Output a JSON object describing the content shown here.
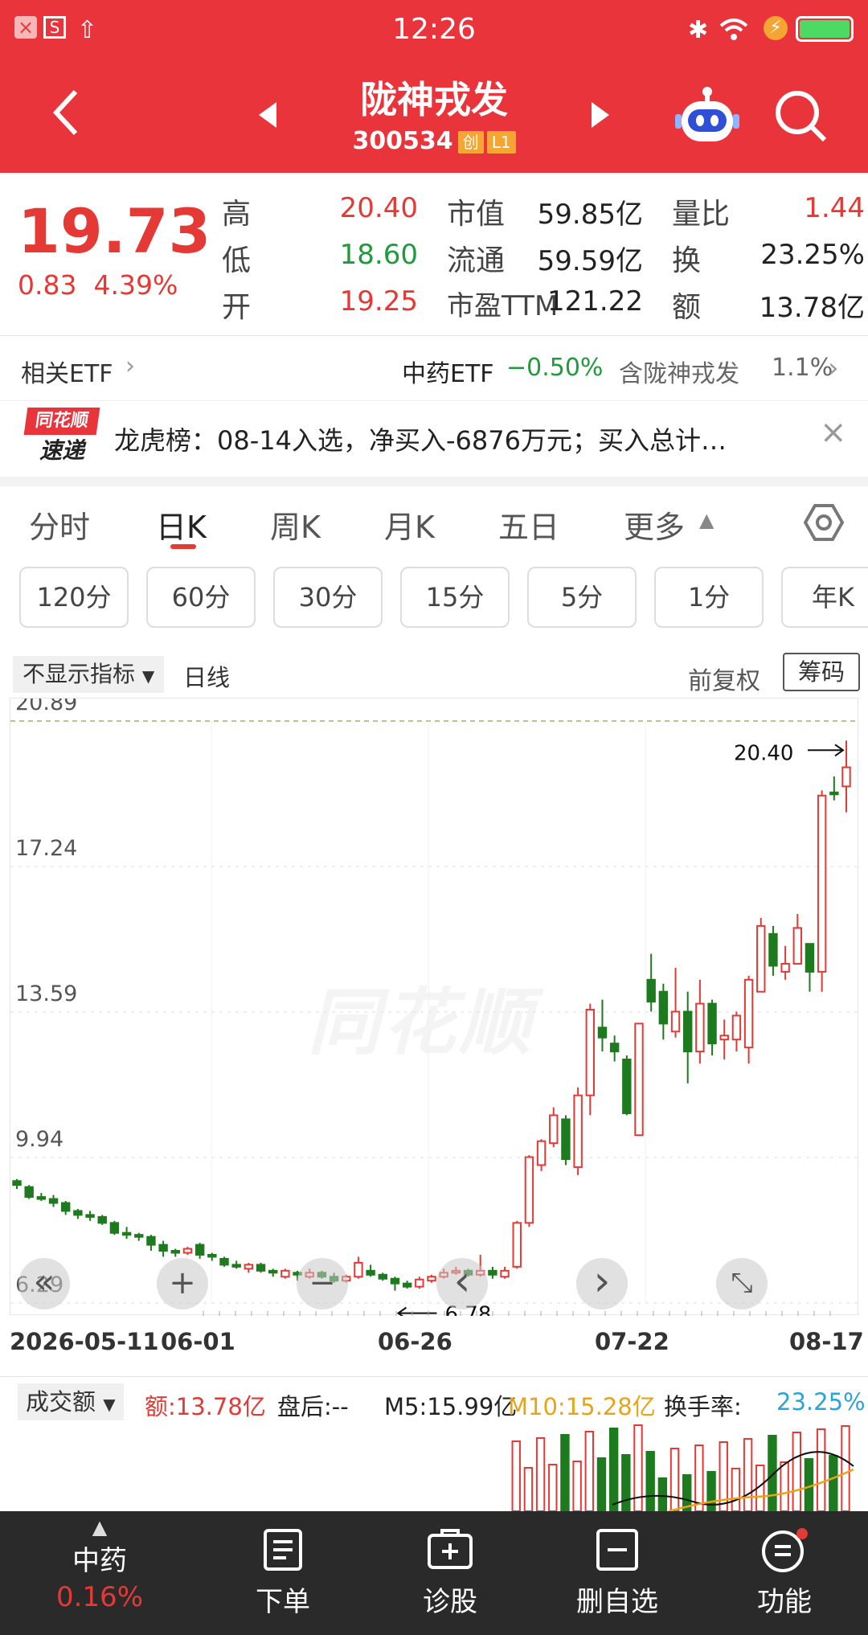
{
  "status_bar": {
    "time": "12:26"
  },
  "header": {
    "stock_name": "陇神戎发",
    "stock_code": "300534",
    "badge1": "创",
    "badge2": "L1"
  },
  "quote": {
    "price": "19.73",
    "change": "0.83",
    "change_pct": "4.39%",
    "high_label": "高",
    "high": "20.40",
    "low_label": "低",
    "low": "18.60",
    "open_label": "开",
    "open": "19.25",
    "mktcap_label": "市值",
    "mktcap": "59.85亿",
    "float_label": "流通",
    "float": "59.59亿",
    "pe_label": "市盈TTM",
    "pe": "121.22",
    "volratio_label": "量比",
    "volratio": "1.44",
    "turnover_label": "换",
    "turnover": "23.25%",
    "amount_label": "额",
    "amount": "13.78亿"
  },
  "etf": {
    "label": "相关ETF",
    "name": "中药ETF",
    "change": "−0.50%",
    "contains": "含陇神戎发",
    "weight": "1.1%"
  },
  "news": {
    "logo_top": "同花顺",
    "logo_bottom": "速递",
    "text": "龙虎榜：08-14入选，净买入-6876万元；买入总计…"
  },
  "tabs": [
    "分时",
    "日K",
    "周K",
    "月K",
    "五日",
    "更多"
  ],
  "periods": [
    "120分",
    "60分",
    "30分",
    "15分",
    "5分",
    "1分",
    "年K"
  ],
  "chart_header": {
    "indicator": "不显示指标",
    "line_type": "日线",
    "adjust": "前复权",
    "chips": "筹码"
  },
  "chart_data": {
    "type": "candlestick",
    "y_ticks": [
      "20.89",
      "17.24",
      "13.59",
      "9.94",
      "6.29"
    ],
    "ylim": [
      6.29,
      20.89
    ],
    "x_labels": [
      "2026-05-11",
      "06-01",
      "06-26",
      "07-22",
      "08-17"
    ],
    "max_marker": "20.40",
    "min_marker": "6.78",
    "candles": [
      {
        "o": 9.35,
        "c": 9.25,
        "h": 9.4,
        "l": 9.15
      },
      {
        "o": 9.2,
        "c": 8.95,
        "h": 9.25,
        "l": 8.9
      },
      {
        "o": 8.95,
        "c": 8.9,
        "h": 9.05,
        "l": 8.85
      },
      {
        "o": 8.9,
        "c": 8.8,
        "h": 9.0,
        "l": 8.7
      },
      {
        "o": 8.8,
        "c": 8.6,
        "h": 8.85,
        "l": 8.5
      },
      {
        "o": 8.6,
        "c": 8.5,
        "h": 8.65,
        "l": 8.4
      },
      {
        "o": 8.5,
        "c": 8.45,
        "h": 8.6,
        "l": 8.35
      },
      {
        "o": 8.45,
        "c": 8.3,
        "h": 8.5,
        "l": 8.25
      },
      {
        "o": 8.3,
        "c": 8.05,
        "h": 8.35,
        "l": 8.0
      },
      {
        "o": 8.05,
        "c": 8.0,
        "h": 8.2,
        "l": 7.9
      },
      {
        "o": 8.0,
        "c": 7.95,
        "h": 8.05,
        "l": 7.85
      },
      {
        "o": 7.95,
        "c": 7.75,
        "h": 8.0,
        "l": 7.6
      },
      {
        "o": 7.75,
        "c": 7.6,
        "h": 7.85,
        "l": 7.45
      },
      {
        "o": 7.6,
        "c": 7.55,
        "h": 7.65,
        "l": 7.45
      },
      {
        "o": 7.55,
        "c": 7.65,
        "h": 7.7,
        "l": 7.5
      },
      {
        "o": 7.75,
        "c": 7.5,
        "h": 7.8,
        "l": 7.4
      },
      {
        "o": 7.5,
        "c": 7.45,
        "h": 7.55,
        "l": 7.35
      },
      {
        "o": 7.4,
        "c": 7.25,
        "h": 7.45,
        "l": 7.2
      },
      {
        "o": 7.25,
        "c": 7.2,
        "h": 7.35,
        "l": 7.15
      },
      {
        "o": 7.15,
        "c": 7.25,
        "h": 7.3,
        "l": 7.05
      },
      {
        "o": 7.25,
        "c": 7.1,
        "h": 7.3,
        "l": 7.05
      },
      {
        "o": 7.1,
        "c": 7.05,
        "h": 7.15,
        "l": 6.95
      },
      {
        "o": 6.95,
        "c": 7.1,
        "h": 7.15,
        "l": 6.9
      },
      {
        "o": 7.05,
        "c": 7.0,
        "h": 7.1,
        "l": 6.85
      },
      {
        "o": 6.95,
        "c": 7.05,
        "h": 7.15,
        "l": 6.9
      },
      {
        "o": 7.05,
        "c": 6.95,
        "h": 7.1,
        "l": 6.9
      },
      {
        "o": 6.95,
        "c": 6.85,
        "h": 7.05,
        "l": 6.8
      },
      {
        "o": 6.85,
        "c": 6.95,
        "h": 7.0,
        "l": 6.8
      },
      {
        "o": 6.95,
        "c": 7.3,
        "h": 7.45,
        "l": 6.9
      },
      {
        "o": 7.1,
        "c": 7.0,
        "h": 7.25,
        "l": 6.95
      },
      {
        "o": 7.0,
        "c": 6.9,
        "h": 7.05,
        "l": 6.85
      },
      {
        "o": 6.9,
        "c": 6.78,
        "h": 6.95,
        "l": 6.6
      },
      {
        "o": 6.78,
        "c": 6.7,
        "h": 6.85,
        "l": 6.65
      },
      {
        "o": 6.7,
        "c": 6.88,
        "h": 6.95,
        "l": 6.65
      },
      {
        "o": 6.85,
        "c": 6.95,
        "h": 7.0,
        "l": 6.8
      },
      {
        "o": 6.95,
        "c": 7.05,
        "h": 7.15,
        "l": 6.9
      },
      {
        "o": 7.05,
        "c": 7.1,
        "h": 7.2,
        "l": 7.0
      },
      {
        "o": 7.1,
        "c": 7.0,
        "h": 7.15,
        "l": 6.95
      },
      {
        "o": 7.0,
        "c": 7.1,
        "h": 7.5,
        "l": 6.95
      },
      {
        "o": 7.1,
        "c": 7.0,
        "h": 7.2,
        "l": 6.9
      },
      {
        "o": 6.95,
        "c": 7.1,
        "h": 7.2,
        "l": 6.9
      },
      {
        "o": 7.2,
        "c": 8.3,
        "h": 8.35,
        "l": 7.15
      },
      {
        "o": 8.3,
        "c": 9.95,
        "h": 10.0,
        "l": 8.2
      },
      {
        "o": 9.75,
        "c": 10.35,
        "h": 10.4,
        "l": 9.6
      },
      {
        "o": 10.3,
        "c": 11.0,
        "h": 11.2,
        "l": 10.2
      },
      {
        "o": 10.9,
        "c": 9.9,
        "h": 11.0,
        "l": 9.75
      },
      {
        "o": 9.7,
        "c": 11.5,
        "h": 11.7,
        "l": 9.5
      },
      {
        "o": 11.5,
        "c": 13.65,
        "h": 13.8,
        "l": 11.0
      },
      {
        "o": 13.2,
        "c": 12.95,
        "h": 13.9,
        "l": 12.6
      },
      {
        "o": 12.8,
        "c": 12.6,
        "h": 13.0,
        "l": 12.35
      },
      {
        "o": 12.4,
        "c": 11.05,
        "h": 12.5,
        "l": 11.0
      },
      {
        "o": 10.5,
        "c": 13.3,
        "h": 13.3,
        "l": 10.5
      },
      {
        "o": 14.4,
        "c": 13.85,
        "h": 15.05,
        "l": 13.6
      },
      {
        "o": 14.1,
        "c": 13.3,
        "h": 14.3,
        "l": 12.9
      },
      {
        "o": 13.1,
        "c": 13.6,
        "h": 14.7,
        "l": 12.95
      },
      {
        "o": 13.6,
        "c": 12.6,
        "h": 14.1,
        "l": 11.8
      },
      {
        "o": 12.6,
        "c": 13.8,
        "h": 14.4,
        "l": 12.3
      },
      {
        "o": 13.8,
        "c": 12.8,
        "h": 13.9,
        "l": 12.5
      },
      {
        "o": 12.9,
        "c": 13.0,
        "h": 13.4,
        "l": 12.4
      },
      {
        "o": 12.9,
        "c": 13.5,
        "h": 13.6,
        "l": 12.6
      },
      {
        "o": 12.7,
        "c": 14.4,
        "h": 14.5,
        "l": 12.3
      },
      {
        "o": 14.1,
        "c": 15.75,
        "h": 15.95,
        "l": 14.1
      },
      {
        "o": 15.55,
        "c": 14.75,
        "h": 15.75,
        "l": 14.5
      },
      {
        "o": 14.6,
        "c": 14.8,
        "h": 15.25,
        "l": 14.4
      },
      {
        "o": 14.8,
        "c": 15.7,
        "h": 16.05,
        "l": 14.8
      },
      {
        "o": 15.3,
        "c": 14.6,
        "h": 15.3,
        "l": 14.1
      },
      {
        "o": 14.6,
        "c": 19.02,
        "h": 19.15,
        "l": 14.1
      },
      {
        "o": 19.1,
        "c": 19.05,
        "h": 19.5,
        "l": 18.9
      },
      {
        "o": 19.25,
        "c": 19.73,
        "h": 20.4,
        "l": 18.6
      }
    ]
  },
  "controls": [
    "«",
    "+",
    "−",
    "‹",
    "›",
    "⤡"
  ],
  "volume_header": {
    "dropdown": "成交额",
    "amount": "额:13.78亿",
    "after_hours": "盘后:--",
    "m5": "M5:15.99亿",
    "m10": "M10:15.28亿",
    "turnover_label": "换手率:",
    "turnover": "23.25%"
  },
  "bottom_nav": {
    "sector_name": "中药",
    "sector_change": "0.16%",
    "items": [
      "下单",
      "诊股",
      "删自选",
      "功能"
    ]
  },
  "colors": {
    "accent": "#e9343b",
    "up": "#e53935",
    "down": "#1e7a1e",
    "bottom_bg": "#2a2a2a"
  }
}
